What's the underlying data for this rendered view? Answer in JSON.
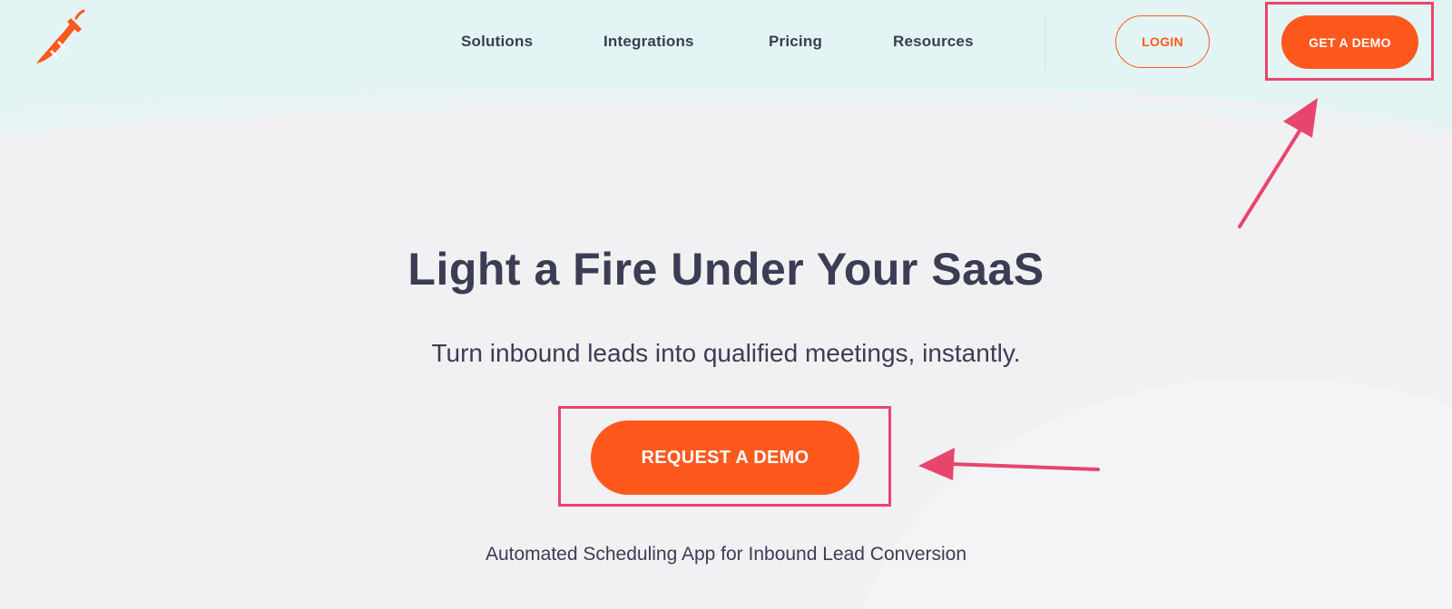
{
  "colors": {
    "accent": "#ff581d",
    "annotation": "#e8456d",
    "header_bg": "#e2f5f4",
    "page_bg": "#f1f1f3",
    "text": "#3b3d54"
  },
  "header": {
    "logo_icon": "chili-pepper-icon",
    "nav": [
      {
        "label": "Solutions"
      },
      {
        "label": "Integrations"
      },
      {
        "label": "Pricing"
      },
      {
        "label": "Resources"
      }
    ],
    "login_label": "LOGIN",
    "get_demo_label": "GET A DEMO"
  },
  "hero": {
    "title": "Light a Fire Under Your SaaS",
    "subtitle": "Turn inbound leads into qualified meetings, instantly.",
    "cta_label": "REQUEST A DEMO",
    "tagline": "Automated Scheduling App for Inbound Lead Conversion"
  },
  "annotations": {
    "highlight_boxes": [
      "get-a-demo",
      "request-a-demo"
    ],
    "arrows": [
      "arrow-to-get-a-demo",
      "arrow-to-request-a-demo"
    ]
  }
}
